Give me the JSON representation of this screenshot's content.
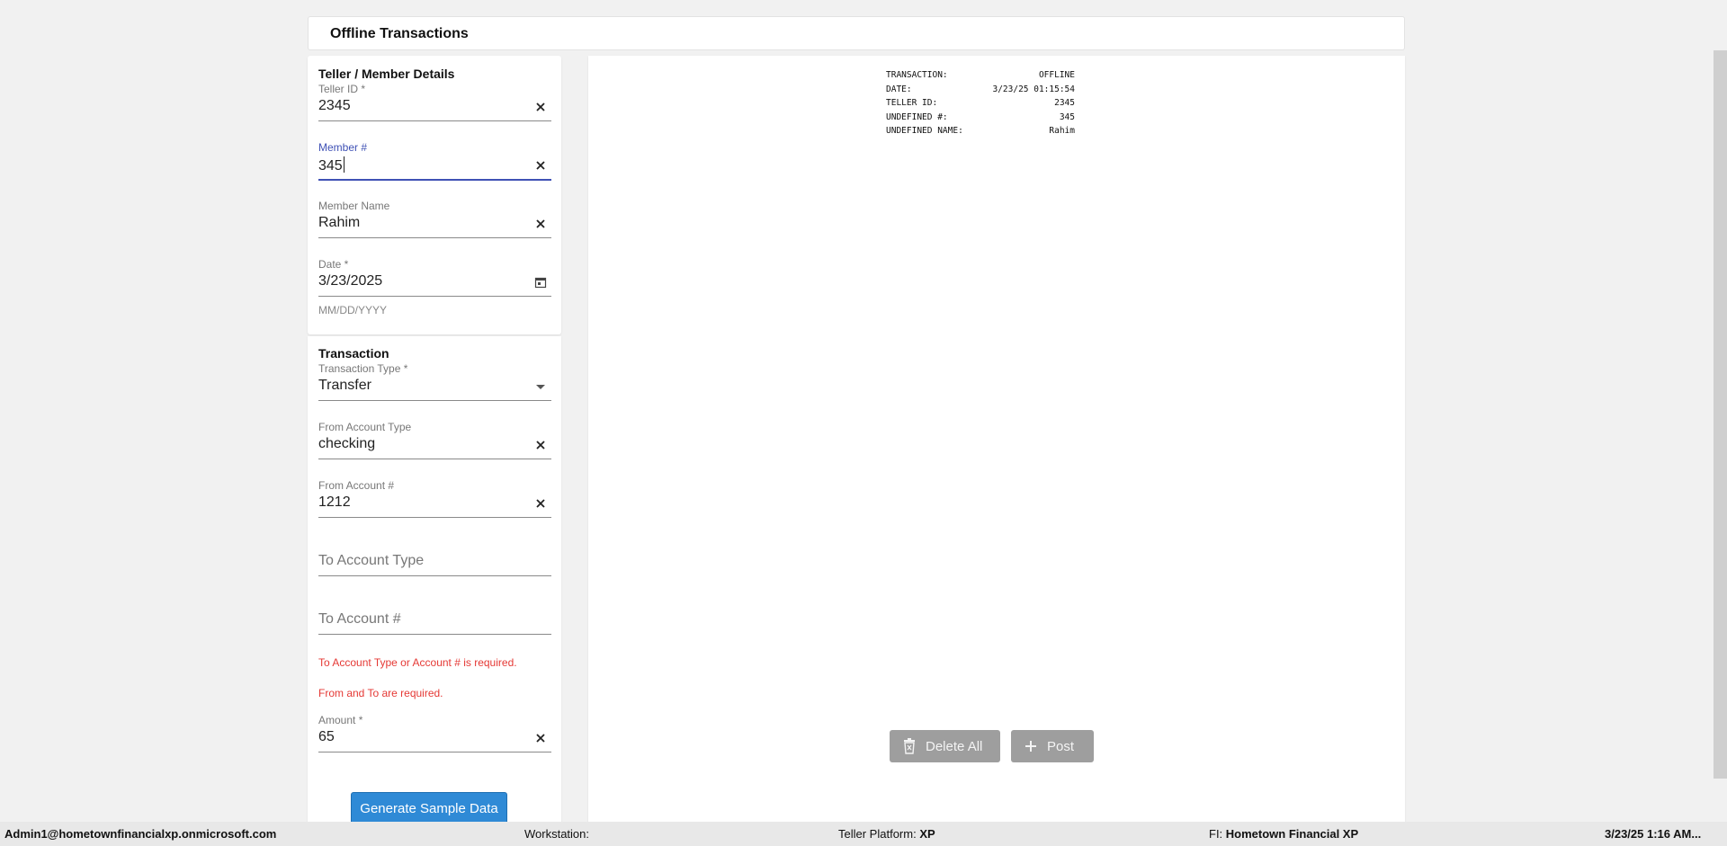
{
  "header": {
    "title": "Offline Transactions"
  },
  "teller_section": {
    "title": "Teller / Member Details",
    "teller_id": {
      "label": "Teller ID *",
      "value": "2345"
    },
    "member_number": {
      "label": "Member #",
      "value": "345"
    },
    "member_name": {
      "label": "Member Name",
      "value": "Rahim"
    },
    "date": {
      "label": "Date *",
      "value": "3/23/2025",
      "hint": "MM/DD/YYYY"
    }
  },
  "transaction_section": {
    "title": "Transaction",
    "transaction_type": {
      "label": "Transaction Type *",
      "value": "Transfer"
    },
    "from_account_type": {
      "label": "From Account Type",
      "value": "checking"
    },
    "from_account_number": {
      "label": "From Account #",
      "value": "1212"
    },
    "to_account_type": {
      "placeholder": "To Account Type"
    },
    "to_account_number": {
      "placeholder": "To Account #"
    },
    "errors": [
      "To Account Type or Account # is required.",
      "From and To are required."
    ],
    "amount": {
      "label": "Amount *",
      "value": "65"
    },
    "generate_button": "Generate Sample Data"
  },
  "receipt": [
    {
      "key": "TRANSACTION:",
      "value": "OFFLINE"
    },
    {
      "key": "DATE:",
      "value": "3/23/25 01:15:54"
    },
    {
      "key": "TELLER ID:",
      "value": "2345"
    },
    {
      "key": "UNDEFINED #:",
      "value": "345"
    },
    {
      "key": "UNDEFINED NAME:",
      "value": "Rahim"
    }
  ],
  "actions": {
    "delete_all": "Delete All",
    "post": "Post"
  },
  "status_bar": {
    "user": "Admin1@hometownfinancialxp.onmicrosoft.com",
    "workstation_label": "Workstation:",
    "teller_platform_label": "Teller Platform:",
    "teller_platform_value": "XP",
    "fi_label": "FI:",
    "fi_value": "Hometown Financial XP",
    "datetime": "3/23/25 1:16 AM..."
  },
  "colors": {
    "accent": "#3f51b5",
    "error": "#e53935",
    "primary_button": "#2f8ad6",
    "disabled_button": "#9e9e9e"
  },
  "icons": {
    "clear": "close-icon",
    "date": "calendar-icon",
    "select": "dropdown-arrow-icon",
    "delete": "trash-icon",
    "post": "plus-icon"
  }
}
